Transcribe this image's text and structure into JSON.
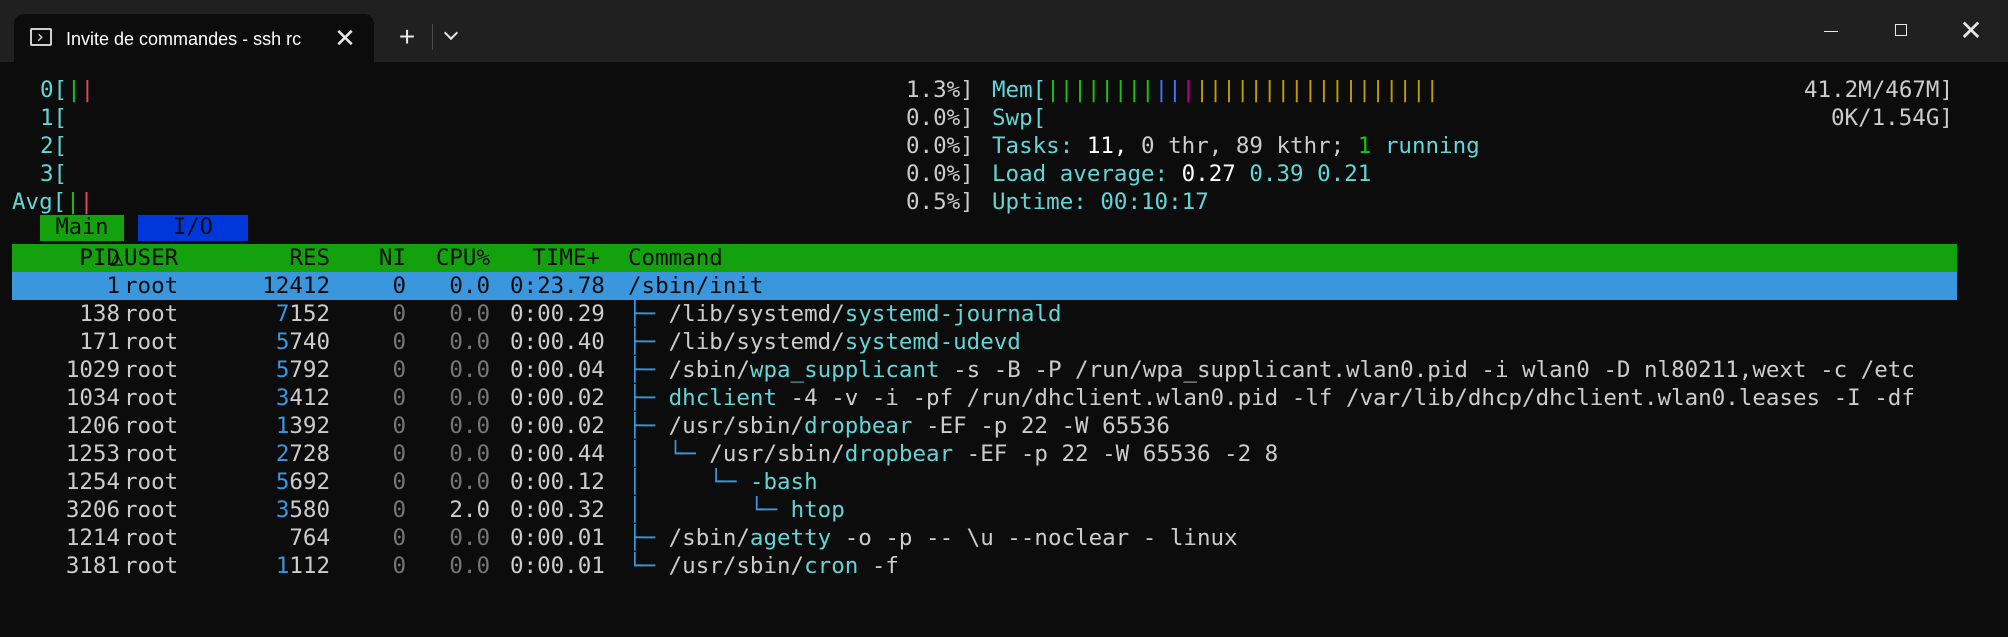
{
  "titlebar": {
    "tab_title": "Invite de commandes - ssh  rc",
    "close_tab": "✕",
    "new_tab": "+",
    "window_close": "✕"
  },
  "meters": {
    "cpus": [
      {
        "label": "0[",
        "end": ""
      },
      {
        "label": "1[",
        "end": ""
      },
      {
        "label": "2[",
        "end": ""
      },
      {
        "label": "3[",
        "end": ""
      },
      {
        "label": "Avg[",
        "end": ""
      }
    ],
    "cpu_percents": [
      "1.3%]",
      "0.0%]",
      "0.0%]",
      "0.0%]",
      "0.5%]"
    ],
    "mem_label": "Mem[",
    "mem_value": "41.2M/467M]",
    "swp_label": "Swp[",
    "swp_value": "0K/1.54G]",
    "tasks_label": "Tasks:",
    "tasks_count": "11,",
    "tasks_thr": "0 thr,",
    "tasks_kthr": "89 kthr;",
    "tasks_running_n": "1",
    "tasks_running": "running",
    "load_label": "Load average:",
    "load_1": "0.27",
    "load_5": "0.39",
    "load_15": "0.21",
    "uptime_label": "Uptime:",
    "uptime": "00:10:17"
  },
  "screen_tabs": {
    "main": "Main",
    "io": "I/O"
  },
  "columns": {
    "pid": "PID",
    "sort_arrow": "△",
    "user": "USER",
    "res": "RES",
    "ni": "NI",
    "cpu": "CPU%",
    "time": "TIME+",
    "command": "Command"
  },
  "processes": [
    {
      "pid": "1",
      "user": "root",
      "res_hi": "",
      "res_lo": "12412",
      "ni": "0",
      "cpu": "0.0",
      "time": "0:23.78",
      "tree": "",
      "path": "/sbin/init",
      "name": "",
      "args": ""
    },
    {
      "pid": "138",
      "user": "root",
      "res_hi": "7",
      "res_lo": "152",
      "ni": "0",
      "cpu": "0.0",
      "time": "0:00.29",
      "tree": "├─ ",
      "path": "/lib/systemd/",
      "name": "systemd-journald",
      "args": ""
    },
    {
      "pid": "171",
      "user": "root",
      "res_hi": "5",
      "res_lo": "740",
      "ni": "0",
      "cpu": "0.0",
      "time": "0:00.40",
      "tree": "├─ ",
      "path": "/lib/systemd/",
      "name": "systemd-udevd",
      "args": ""
    },
    {
      "pid": "1029",
      "user": "root",
      "res_hi": "5",
      "res_lo": "792",
      "ni": "0",
      "cpu": "0.0",
      "time": "0:00.04",
      "tree": "├─ ",
      "path": "/sbin/",
      "name": "wpa_supplicant",
      "args": " -s -B -P /run/wpa_supplicant.wlan0.pid -i wlan0 -D nl80211,wext -c /etc"
    },
    {
      "pid": "1034",
      "user": "root",
      "res_hi": "3",
      "res_lo": "412",
      "ni": "0",
      "cpu": "0.0",
      "time": "0:00.02",
      "tree": "├─ ",
      "path": "",
      "name": "dhclient",
      "args": " -4 -v -i -pf /run/dhclient.wlan0.pid -lf /var/lib/dhcp/dhclient.wlan0.leases -I -df"
    },
    {
      "pid": "1206",
      "user": "root",
      "res_hi": "1",
      "res_lo": "392",
      "ni": "0",
      "cpu": "0.0",
      "time": "0:00.02",
      "tree": "├─ ",
      "path": "/usr/sbin/",
      "name": "dropbear",
      "args": " -EF -p 22 -W 65536"
    },
    {
      "pid": "1253",
      "user": "root",
      "res_hi": "2",
      "res_lo": "728",
      "ni": "0",
      "cpu": "0.0",
      "time": "0:00.44",
      "tree": "│  └─ ",
      "path": "/usr/sbin/",
      "name": "dropbear",
      "args": " -EF -p 22 -W 65536 -2 8"
    },
    {
      "pid": "1254",
      "user": "root",
      "res_hi": "5",
      "res_lo": "692",
      "ni": "0",
      "cpu": "0.0",
      "time": "0:00.12",
      "tree": "│     └─ ",
      "path": "",
      "name": "-bash",
      "args": ""
    },
    {
      "pid": "3206",
      "user": "root",
      "res_hi": "3",
      "res_lo": "580",
      "ni": "0",
      "cpu": "2.0",
      "time": "0:00.32",
      "tree": "│        └─ ",
      "path": "",
      "name": "htop",
      "args": ""
    },
    {
      "pid": "1214",
      "user": "root",
      "res_hi": "",
      "res_lo": "764",
      "ni": "0",
      "cpu": "0.0",
      "time": "0:00.01",
      "tree": "├─ ",
      "path": "/sbin/",
      "name": "agetty",
      "args": " -o -p -- \\u --noclear - linux"
    },
    {
      "pid": "3181",
      "user": "root",
      "res_hi": "1",
      "res_lo": "112",
      "ni": "0",
      "cpu": "0.0",
      "time": "0:00.01",
      "tree": "└─ ",
      "path": "/usr/sbin/",
      "name": "cron",
      "args": " -f"
    }
  ],
  "colors": {
    "header_green": "#13a10e",
    "selection_blue": "#3a96dd",
    "cyan": "#61d6d6",
    "background": "#0c0c0c"
  }
}
